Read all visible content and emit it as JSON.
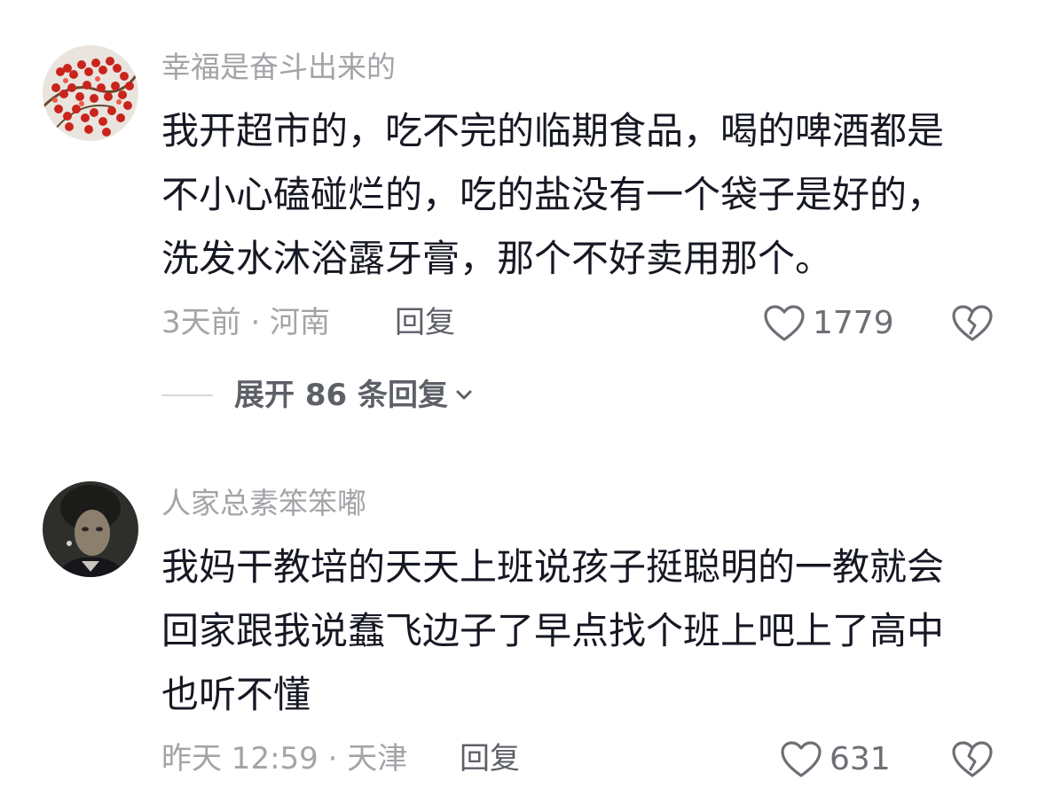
{
  "comments": [
    {
      "username": "幸福是奋斗出来的",
      "avatar_icon": "red-berries-avatar",
      "lines": [
        "我开超市的，吃不完的临期食品，喝的啤酒都是",
        "不小心磕碰烂的，吃的盐没有一个袋子是好的，",
        "洗发水沐浴露牙膏，那个不好卖用那个。"
      ],
      "meta": "3天前 · 河南",
      "reply_label": "回复",
      "likes": "1779",
      "expand_label": "展开 86 条回复"
    },
    {
      "username": "人家总素笨笨嘟",
      "avatar_icon": "dark-portrait-avatar",
      "lines": [
        "我妈干教培的天天上班说孩子挺聪明的一教就会",
        "回家跟我说蠢飞边子了早点找个班上吧上了高中",
        "也听不懂"
      ],
      "meta": "昨天 12:59 · 天津",
      "reply_label": "回复",
      "likes": "631"
    }
  ],
  "colors": {
    "text_primary": "#161823",
    "text_secondary": "#a3a4a8",
    "reply": "#5e6068",
    "icon": "#6d6f76"
  },
  "icons": [
    "heart-icon",
    "broken-heart-icon",
    "chevron-down-icon"
  ]
}
